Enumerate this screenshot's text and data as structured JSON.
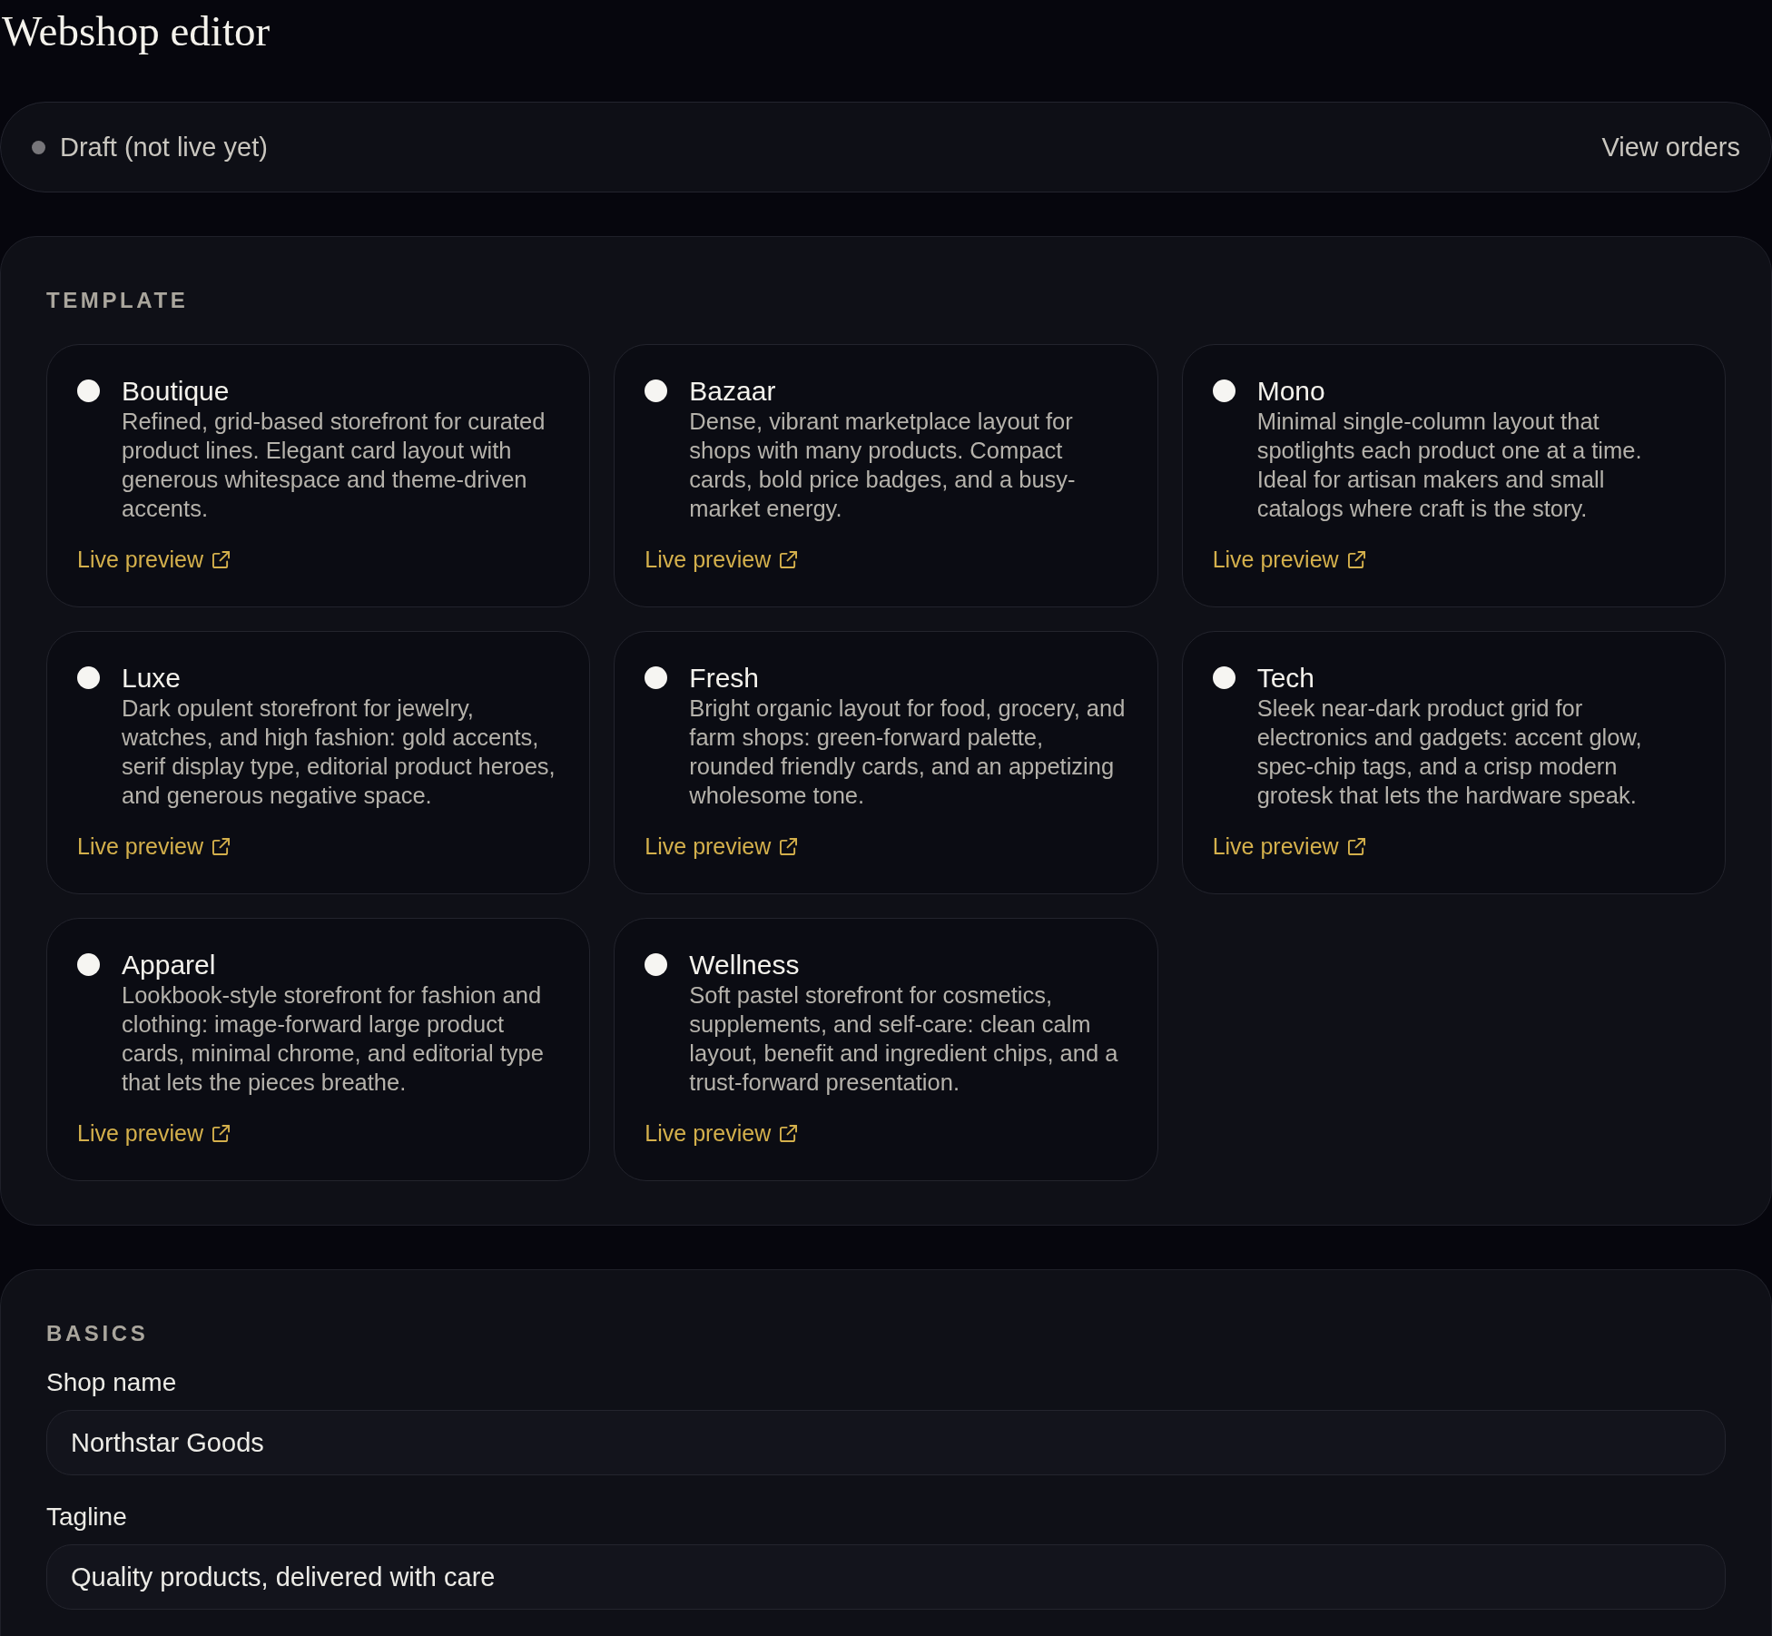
{
  "page": {
    "title": "Webshop editor"
  },
  "status_bar": {
    "label": "Draft (not live yet)",
    "live": false,
    "action": "View orders"
  },
  "template": {
    "heading": "TEMPLATE",
    "options": [
      {
        "name": "Boutique",
        "description": "Refined, grid-based storefront for curated product lines. Elegant card layout with generous whitespace and theme-driven accents.",
        "selected": false,
        "link": "Live preview"
      },
      {
        "name": "Bazaar",
        "description": "Dense, vibrant marketplace layout for shops with many products. Compact cards, bold price badges, and a busy-market energy.",
        "selected": false,
        "link": "Live preview"
      },
      {
        "name": "Mono",
        "description": "Minimal single-column layout that spotlights each product one at a time. Ideal for artisan makers and small catalogs where craft is the story.",
        "selected": false,
        "link": "Live preview"
      },
      {
        "name": "Luxe",
        "description": "Dark opulent storefront for jewelry, watches, and high fashion: gold accents, serif display type, editorial product heroes, and generous negative space.",
        "selected": false,
        "link": "Live preview"
      },
      {
        "name": "Fresh",
        "description": "Bright organic layout for food, grocery, and farm shops: green-forward palette, rounded friendly cards, and an appetizing wholesome tone.",
        "selected": false,
        "link": "Live preview"
      },
      {
        "name": "Tech",
        "description": "Sleek near-dark product grid for electronics and gadgets: accent glow, spec-chip tags, and a crisp modern grotesk that lets the hardware speak.",
        "selected": false,
        "link": "Live preview"
      },
      {
        "name": "Apparel",
        "description": "Lookbook-style storefront for fashion and clothing: image-forward large product cards, minimal chrome, and editorial type that lets the pieces breathe.",
        "selected": false,
        "link": "Live preview"
      },
      {
        "name": "Wellness",
        "description": "Soft pastel storefront for cosmetics, supplements, and self-care: clean calm layout, benefit and ingredient chips, and a trust-forward presentation.",
        "selected": false,
        "link": "Live preview"
      }
    ]
  },
  "basics": {
    "heading": "BASICS",
    "fields": [
      {
        "label": "Shop name",
        "value": "Northstar Goods"
      },
      {
        "label": "Tagline",
        "value": "Quality products, delivered with care"
      }
    ]
  }
}
